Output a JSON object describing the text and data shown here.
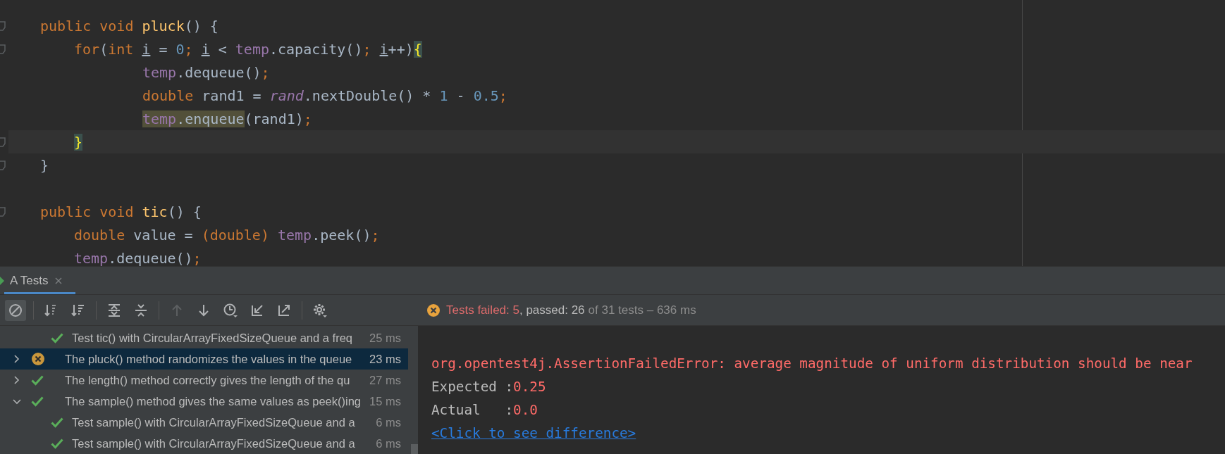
{
  "editor": {
    "lines": [
      {
        "current": false,
        "tokens": [
          {
            "text": "public void ",
            "kind": "keyword"
          },
          {
            "text": "pluck",
            "kind": "declaration"
          },
          {
            "text": "() {",
            "kind": "plain"
          }
        ],
        "children": [
          {
            "current": false,
            "tokens": [
              {
                "text": "for",
                "kind": "keyword"
              },
              {
                "text": "(",
                "kind": "plain"
              },
              {
                "text": "int ",
                "kind": "keyword"
              },
              {
                "text": "i",
                "kind": "plain",
                "underline": true
              },
              {
                "text": " = ",
                "kind": "plain"
              },
              {
                "text": "0",
                "kind": "number"
              },
              {
                "text": "; ",
                "kind": "keyword"
              },
              {
                "text": "i",
                "kind": "plain",
                "underline": true
              },
              {
                "text": " < ",
                "kind": "plain"
              },
              {
                "text": "temp",
                "kind": "field"
              },
              {
                "text": ".capacity()",
                "kind": "plain"
              },
              {
                "text": "; ",
                "kind": "keyword"
              },
              {
                "text": "i",
                "kind": "plain",
                "underline": true
              },
              {
                "text": "++)",
                "kind": "plain"
              },
              {
                "text": "{",
                "kind": "brace"
              }
            ],
            "children": [
              {
                "current": false,
                "tokens": [
                  {
                    "text": "temp",
                    "kind": "field"
                  },
                  {
                    "text": ".dequeue()",
                    "kind": "plain"
                  },
                  {
                    "text": ";",
                    "kind": "keyword"
                  }
                ]
              },
              {
                "current": false,
                "tokens": [
                  {
                    "text": "double ",
                    "kind": "keyword"
                  },
                  {
                    "text": "rand1 = ",
                    "kind": "plain"
                  },
                  {
                    "text": "rand",
                    "kind": "static"
                  },
                  {
                    "text": ".nextDouble() * ",
                    "kind": "plain"
                  },
                  {
                    "text": "1",
                    "kind": "number"
                  },
                  {
                    "text": " - ",
                    "kind": "plain"
                  },
                  {
                    "text": "0.5",
                    "kind": "number"
                  },
                  {
                    "text": ";",
                    "kind": "keyword"
                  }
                ]
              },
              {
                "current": false,
                "tokens": [
                  {
                    "text": "temp",
                    "kind": "field",
                    "highlight": true
                  },
                  {
                    "text": ".enqueue",
                    "kind": "plain",
                    "highlight": true
                  },
                  {
                    "text": "(rand1)",
                    "kind": "plain"
                  },
                  {
                    "text": ";",
                    "kind": "keyword"
                  }
                ]
              }
            ]
          },
          {
            "current": true,
            "tokens": [
              {
                "text": "}",
                "kind": "brace"
              }
            ]
          }
        ]
      },
      {
        "current": false,
        "tokens": [
          {
            "text": "}",
            "kind": "plain"
          }
        ]
      },
      {
        "current": false
      },
      {
        "current": false,
        "tokens": [
          {
            "text": "public void ",
            "kind": "keyword"
          },
          {
            "text": "tic",
            "kind": "declaration"
          },
          {
            "text": "() {",
            "kind": "plain"
          }
        ],
        "children": [
          {
            "current": false,
            "tokens": [
              {
                "text": "double ",
                "kind": "keyword"
              },
              {
                "text": "value = ",
                "kind": "plain"
              },
              {
                "text": "(double) ",
                "kind": "keyword"
              },
              {
                "text": "temp",
                "kind": "field"
              },
              {
                "text": ".peek()",
                "kind": "plain"
              },
              {
                "text": ";",
                "kind": "keyword"
              }
            ]
          },
          {
            "current": false,
            "tokens": [
              {
                "text": "temp",
                "kind": "field"
              },
              {
                "text": ".dequeue()",
                "kind": "plain"
              },
              {
                "text": ";",
                "kind": "keyword"
              }
            ]
          }
        ]
      }
    ]
  },
  "panel": {
    "tabs": [
      {
        "label": "A Tests",
        "selected": true
      }
    ],
    "toolbar": [
      {
        "kind": "show-passed",
        "on": true,
        "disabled": false
      },
      {
        "kind": "separator"
      },
      {
        "kind": "sort-alpha",
        "on": false,
        "disabled": false
      },
      {
        "kind": "sort-duration",
        "on": false,
        "disabled": false
      },
      {
        "kind": "separator"
      },
      {
        "kind": "expand-all",
        "on": false,
        "disabled": false
      },
      {
        "kind": "collapse-all",
        "on": false,
        "disabled": false
      },
      {
        "kind": "separator"
      },
      {
        "kind": "previous",
        "on": false,
        "disabled": true
      },
      {
        "kind": "next",
        "on": false,
        "disabled": false
      },
      {
        "kind": "history",
        "on": false,
        "disabled": false
      },
      {
        "kind": "import",
        "on": false,
        "disabled": false
      },
      {
        "kind": "export",
        "on": false,
        "disabled": false
      },
      {
        "kind": "separator"
      },
      {
        "kind": "settings",
        "on": false,
        "disabled": false
      }
    ],
    "status": {
      "failed": "Tests failed: 5",
      "passed": ", passed: 26",
      "total": "of 31 tests – 636 ms"
    },
    "tree": {
      "continued_children": [
        {
          "label": "Test tic() with CircularArrayFixedSizeQueue and a freq",
          "failed": false,
          "time": "25 ms",
          "selected": false
        }
      ],
      "nodes": [
        {
          "label": "The pluck() method randomizes the values in the queue",
          "failed": true,
          "time": "23 ms",
          "selected": true,
          "expanded": false
        },
        {
          "label": "The length() method correctly gives the length of the qu",
          "failed": false,
          "time": "27 ms",
          "selected": false,
          "expanded": false
        },
        {
          "label": "The sample() method gives the same values as peek()ing",
          "failed": false,
          "time": "15 ms",
          "selected": false,
          "expanded": true,
          "children": [
            {
              "label": "Test sample() with CircularArrayFixedSizeQueue and a",
              "failed": false,
              "time": "6 ms",
              "selected": false
            },
            {
              "label": "Test sample() with CircularArrayFixedSizeQueue and a",
              "failed": false,
              "time": "6 ms",
              "selected": false
            }
          ]
        }
      ]
    },
    "output": [
      {
        "kind": "error",
        "text": "org.opentest4j.AssertionFailedError: average magnitude of uniform distribution should be near"
      },
      {
        "kind": "comparison",
        "label": "Expected :",
        "value": "0.25"
      },
      {
        "kind": "comparison",
        "label": "Actual   :",
        "value": "0.0"
      },
      {
        "kind": "link",
        "text": "<Click to see difference>"
      }
    ]
  }
}
